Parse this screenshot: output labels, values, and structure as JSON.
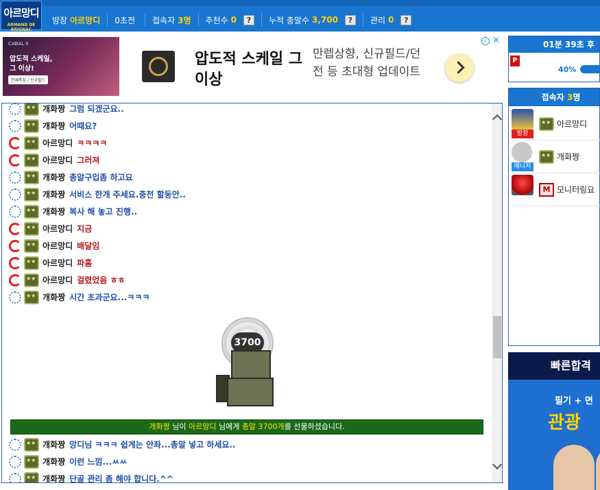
{
  "header": {
    "logo_line1": "아르망디",
    "logo_line2": "ARMAND DE BRIGNAC",
    "host_label": "방장",
    "host_name": "아르망디",
    "ext_label": "0초전",
    "viewers_label": "접속자",
    "viewers_count": "3명",
    "recommend_label": "추천수",
    "recommend_count": "0",
    "bullets_label": "누적 총알수",
    "bullets_count": "3,700",
    "manage_label": "관리",
    "manage_count": "0",
    "help_symbol": "?"
  },
  "ad_top": {
    "brand": "CABAL II",
    "image_text": "압도적 스케일,\n그 이상!",
    "image_cta": "연쇄특집 / 신규필드",
    "headline": "압도적 스케일 그이상",
    "description": "만렙상향, 신규필드/던전 등 초대형 업데이트",
    "info_symbol": "i",
    "close_symbol": "✕"
  },
  "chat": {
    "messages_before": [
      {
        "nick": "개화짱",
        "text": "그럼 되겠군요..",
        "role": "guest"
      },
      {
        "nick": "개화짱",
        "text": "어때요?",
        "role": "guest"
      },
      {
        "nick": "아르망디",
        "text": "ㅋㅋㅋㅋ",
        "role": "host"
      },
      {
        "nick": "아르망디",
        "text": "그러져",
        "role": "host"
      },
      {
        "nick": "개화짱",
        "text": "총알구입좀 하고요",
        "role": "guest"
      },
      {
        "nick": "개화짱",
        "text": "서비스 한개 주세요.충전 할동안..",
        "role": "guest"
      },
      {
        "nick": "개화짱",
        "text": "복사 해 놓고 진행..",
        "role": "guest"
      },
      {
        "nick": "아르망디",
        "text": "지금",
        "role": "host"
      },
      {
        "nick": "아르망디",
        "text": "배달임",
        "role": "host"
      },
      {
        "nick": "아르망디",
        "text": "파홈",
        "role": "host"
      },
      {
        "nick": "아르망디",
        "text": "걸렸었음 ㅎㅎ",
        "role": "host"
      },
      {
        "nick": "개화짱",
        "text": "시간 초과군요...ㅋㅋㅋ",
        "role": "guest"
      }
    ],
    "gift": {
      "amount": "3700",
      "from": "개화짱",
      "from_suffix": " 님이 ",
      "to": "아르망디",
      "to_suffix": " 님에게 ",
      "item": "총알 3700개",
      "end": "를 선물하셨습니다."
    },
    "messages_after": [
      {
        "nick": "개화짱",
        "text": "망디님 ㅋㅋㅋ 쉽게는 안좌...총알 넣고 하세요..",
        "role": "guest"
      },
      {
        "nick": "개화짱",
        "text": "이런 느낌...ㅆㅆ",
        "role": "guest"
      },
      {
        "nick": "개화짱",
        "text": "단골 관리 좀 해야 합니다.^^",
        "role": "guest"
      }
    ]
  },
  "timer": {
    "text": "01분 39초 후 6",
    "p_symbol": "P",
    "percent_text": "40%",
    "percent": 0.4
  },
  "users_panel": {
    "title": "접속자",
    "count": "3",
    "count_suffix": "명",
    "users": [
      {
        "name": "아르망디",
        "role": "방장"
      },
      {
        "name": "개화짱",
        "role": "매니저"
      },
      {
        "name": "모니터링요",
        "role": ""
      }
    ]
  },
  "ad_side": {
    "top": "빠른합격",
    "line1": "필기 + 면",
    "line2": "관광"
  },
  "colors": {
    "header_blue": "#1876d1",
    "accent_yellow": "#ffd400",
    "host_red": "#b21818",
    "guest_blue": "#1f4fa8",
    "gift_green": "#1a6a1a"
  }
}
